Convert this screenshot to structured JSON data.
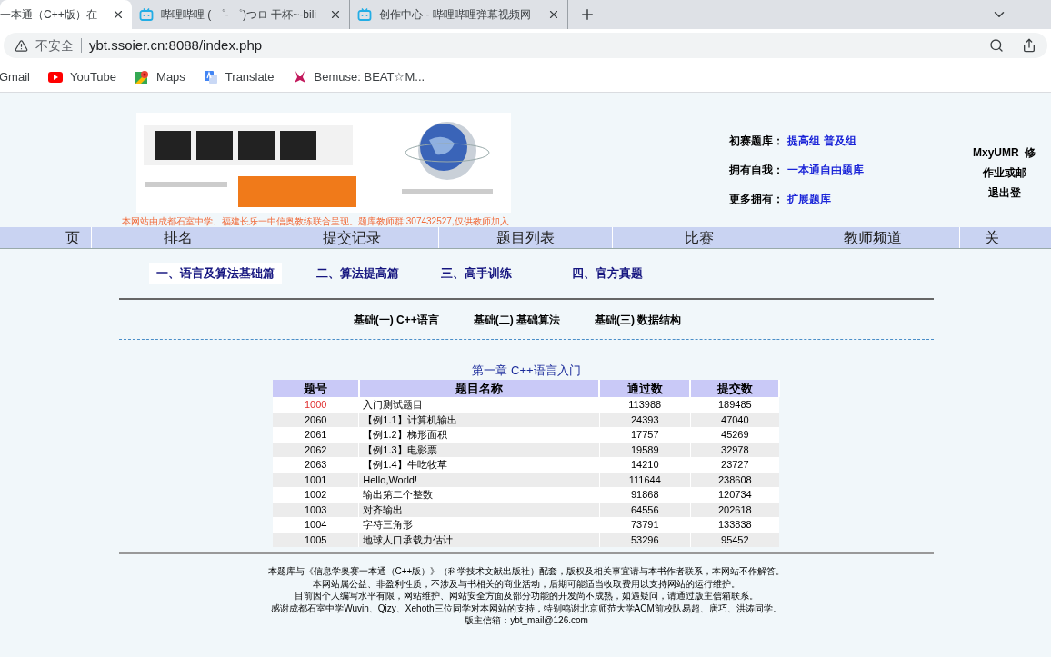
{
  "browser": {
    "tabs": [
      {
        "title": "一本通（C++版）在",
        "selected": true
      },
      {
        "title": "哔哩哔哩 ( ゜- ゜)つロ 干杯~-bili",
        "selected": false
      },
      {
        "title": "创作中心 - 哔哩哔哩弹幕视频网",
        "selected": false
      }
    ],
    "security": "不安全",
    "url": "ybt.ssoier.cn:8088/index.php",
    "bookmarks": [
      {
        "label": "Gmail",
        "kind": "plain"
      },
      {
        "label": "YouTube",
        "kind": "youtube"
      },
      {
        "label": "Maps",
        "kind": "maps"
      },
      {
        "label": "Translate",
        "kind": "translate"
      },
      {
        "label": "Bemuse: BEAT☆M...",
        "kind": "bemuse"
      }
    ]
  },
  "header": {
    "notice": "本网站由成都石室中学、福建长乐一中信奥教练联合呈现。题库教师群:307432527,仅供教师加入",
    "links": [
      {
        "label": "初赛题库：",
        "items": [
          "提高组",
          "普及组"
        ]
      },
      {
        "label": "拥有自我：",
        "items": [
          "一本通自由题库"
        ]
      },
      {
        "label": "更多拥有：",
        "items": [
          "扩展题库"
        ]
      }
    ],
    "user": [
      "MxyUMR  修",
      "作业或邮",
      "退出登"
    ]
  },
  "nav": [
    "页",
    "排名",
    "提交记录",
    "题目列表",
    "比赛",
    "教师频道",
    "关"
  ],
  "sections": [
    {
      "label": "一、语言及算法基础篇",
      "selected": true
    },
    {
      "label": "二、算法提高篇",
      "selected": false
    },
    {
      "label": "三、高手训练",
      "selected": false
    },
    {
      "label": "四、官方真题",
      "selected": false
    }
  ],
  "subsections": [
    "基础(一) C++语言",
    "基础(二) 基础算法",
    "基础(三) 数据结构"
  ],
  "table": {
    "title": "第一章 C++语言入门",
    "columns": [
      "题号",
      "题目名称",
      "通过数",
      "提交数"
    ],
    "rows": [
      {
        "id": "1000",
        "name": "入门测试题目",
        "passed": "113988",
        "submitted": "189485",
        "highlighted": true
      },
      {
        "id": "2060",
        "name": "【例1.1】计算机输出",
        "passed": "24393",
        "submitted": "47040",
        "highlighted": false
      },
      {
        "id": "2061",
        "name": "【例1.2】梯形面积",
        "passed": "17757",
        "submitted": "45269",
        "highlighted": false
      },
      {
        "id": "2062",
        "name": "【例1.3】电影票",
        "passed": "19589",
        "submitted": "32978",
        "highlighted": false
      },
      {
        "id": "2063",
        "name": "【例1.4】牛吃牧草",
        "passed": "14210",
        "submitted": "23727",
        "highlighted": false
      },
      {
        "id": "1001",
        "name": "Hello,World!",
        "passed": "111644",
        "submitted": "238608",
        "highlighted": false
      },
      {
        "id": "1002",
        "name": "输出第二个整数",
        "passed": "91868",
        "submitted": "120734",
        "highlighted": false
      },
      {
        "id": "1003",
        "name": "对齐输出",
        "passed": "64556",
        "submitted": "202618",
        "highlighted": false
      },
      {
        "id": "1004",
        "name": "字符三角形",
        "passed": "73791",
        "submitted": "133838",
        "highlighted": false
      },
      {
        "id": "1005",
        "name": "地球人口承载力估计",
        "passed": "53296",
        "submitted": "95452",
        "highlighted": false
      }
    ]
  },
  "footer": [
    "本题库与《信息学奥赛一本通（C++版）》（科学技术文献出版社）配套，版权及相关事宜请与本书作者联系，本网站不作解答。",
    "本网站属公益、非盈利性质，不涉及与书相关的商业活动，后期可能适当收取费用以支持网站的运行维护。",
    "目前因个人编写水平有限，网站维护、网站安全方面及部分功能的开发尚不成熟，如遇疑问，请通过版主信箱联系。",
    "感谢成都石室中学Wuvin、Qizy、Xehoth三位同学对本网站的支持，特别鸣谢北京师范大学ACM前校队易超、唐巧、洪涛同学。",
    "版主信箱：ybt_mail@126.com"
  ]
}
